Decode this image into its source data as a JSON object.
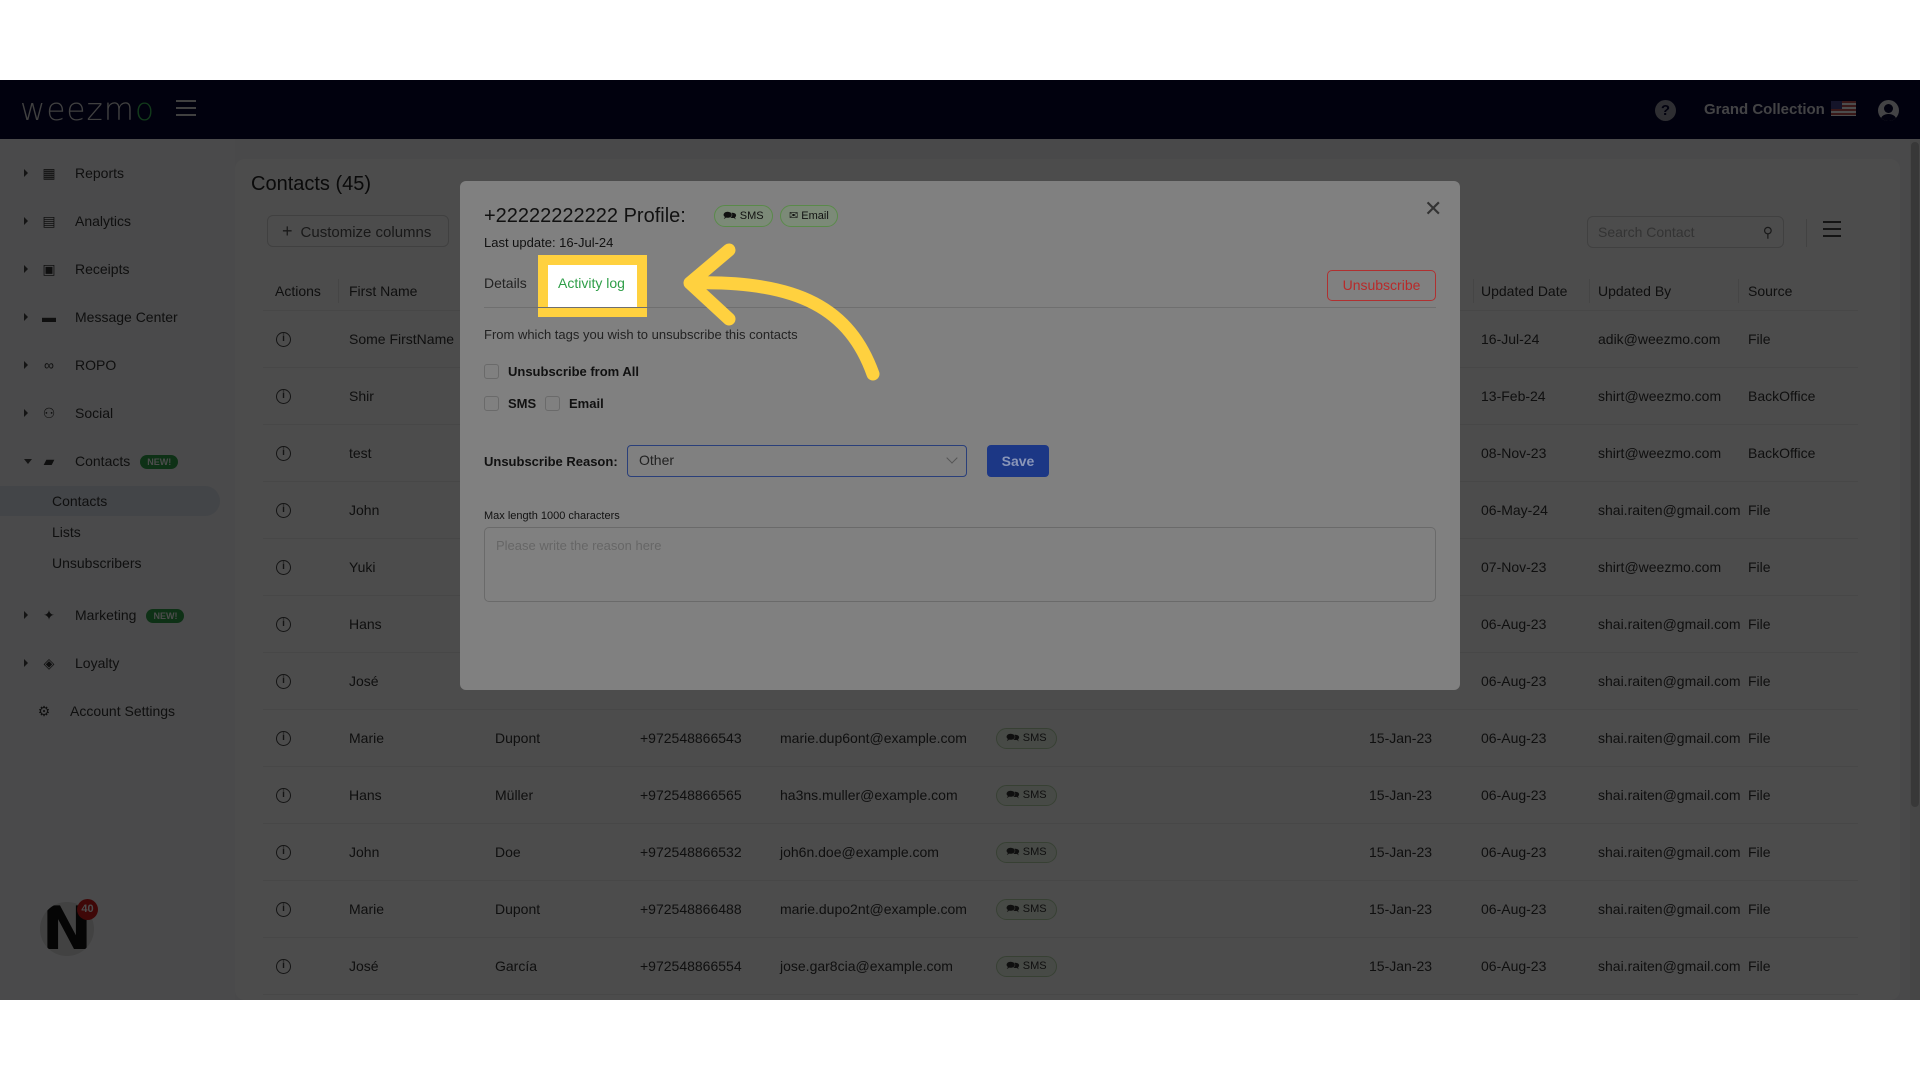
{
  "app": {
    "logo": "weezm",
    "logo_accent": "o",
    "store_name": "Grand Collection",
    "help_icon": "?"
  },
  "sidebar": {
    "items": [
      {
        "label": "Reports",
        "icon": "grid-icon"
      },
      {
        "label": "Analytics",
        "icon": "bar-chart-icon"
      },
      {
        "label": "Receipts",
        "icon": "receipt-icon"
      },
      {
        "label": "Message Center",
        "icon": "chat-icon"
      },
      {
        "label": "ROPO",
        "icon": "infinity-icon"
      },
      {
        "label": "Social",
        "icon": "people-icon"
      },
      {
        "label": "Contacts",
        "icon": "contact-book-icon",
        "badge": "NEW!",
        "expanded": true
      },
      {
        "label": "Marketing",
        "icon": "party-popper-icon",
        "badge": "NEW!"
      },
      {
        "label": "Loyalty",
        "icon": "tag-icon"
      },
      {
        "label": "Account Settings",
        "icon": "gear-icon"
      }
    ],
    "contacts_sub": [
      "Contacts",
      "Lists",
      "Unsubscribers"
    ],
    "active_sub": "Contacts",
    "notification_count": "40"
  },
  "main": {
    "title": "Contacts (45)",
    "customize_label": "Customize columns",
    "search_placeholder": "Search Contact",
    "columns": [
      "Actions",
      "First Name",
      "Updated Date",
      "Updated By",
      "Source"
    ],
    "rows": [
      {
        "first": "Some FirstName",
        "last": "",
        "phone": "",
        "email": "",
        "channel": "",
        "created": "",
        "updated": "16-Jul-24",
        "by": "adik@weezmo.com",
        "source": "File"
      },
      {
        "first": "Shir",
        "last": "",
        "phone": "",
        "email": "",
        "channel": "",
        "created": "",
        "updated": "13-Feb-24",
        "by": "shirt@weezmo.com",
        "source": "BackOffice"
      },
      {
        "first": "test",
        "last": "",
        "phone": "",
        "email": "",
        "channel": "",
        "created": "",
        "updated": "08-Nov-23",
        "by": "shirt@weezmo.com",
        "source": "BackOffice"
      },
      {
        "first": "John",
        "last": "",
        "phone": "",
        "email": "",
        "channel": "",
        "created": "",
        "updated": "06-May-24",
        "by": "shai.raiten@gmail.com",
        "source": "File"
      },
      {
        "first": "Yuki",
        "last": "",
        "phone": "",
        "email": "",
        "channel": "",
        "created": "",
        "updated": "07-Nov-23",
        "by": "shirt@weezmo.com",
        "source": "File"
      },
      {
        "first": "Hans",
        "last": "",
        "phone": "",
        "email": "",
        "channel": "",
        "created": "",
        "updated": "06-Aug-23",
        "by": "shai.raiten@gmail.com",
        "source": "File"
      },
      {
        "first": "José",
        "last": "",
        "phone": "",
        "email": "",
        "channel": "",
        "created": "",
        "updated": "06-Aug-23",
        "by": "shai.raiten@gmail.com",
        "source": "File"
      },
      {
        "first": "Marie",
        "last": "Dupont",
        "phone": "+972548866543",
        "email": "marie.dup6ont@example.com",
        "channel": "SMS",
        "created": "15-Jan-23",
        "updated": "06-Aug-23",
        "by": "shai.raiten@gmail.com",
        "source": "File"
      },
      {
        "first": "Hans",
        "last": "Müller",
        "phone": "+972548866565",
        "email": "ha3ns.muller@example.com",
        "channel": "SMS",
        "created": "15-Jan-23",
        "updated": "06-Aug-23",
        "by": "shai.raiten@gmail.com",
        "source": "File"
      },
      {
        "first": "John",
        "last": "Doe",
        "phone": "+972548866532",
        "email": "joh6n.doe@example.com",
        "channel": "SMS",
        "created": "15-Jan-23",
        "updated": "06-Aug-23",
        "by": "shai.raiten@gmail.com",
        "source": "File"
      },
      {
        "first": "Marie",
        "last": "Dupont",
        "phone": "+972548866488",
        "email": "marie.dupo2nt@example.com",
        "channel": "SMS",
        "created": "15-Jan-23",
        "updated": "06-Aug-23",
        "by": "shai.raiten@gmail.com",
        "source": "File"
      },
      {
        "first": "José",
        "last": "García",
        "phone": "+972548866554",
        "email": "jose.gar8cia@example.com",
        "channel": "SMS",
        "created": "15-Jan-23",
        "updated": "06-Aug-23",
        "by": "shai.raiten@gmail.com",
        "source": "File"
      }
    ]
  },
  "modal": {
    "title": "+22222222222 Profile:",
    "chips": [
      "SMS",
      "Email"
    ],
    "last_update": "Last update: 16-Jul-24",
    "tabs": [
      "Details",
      "Activity log"
    ],
    "highlighted_tab": "Activity log",
    "unsubscribe_label": "Unsubscribe",
    "question": "From which tags you wish to unsubscribe this contacts",
    "checkboxes": [
      {
        "label": "Unsubscribe from All",
        "checked": false
      },
      {
        "label": "SMS",
        "checked": false
      },
      {
        "label": "Email",
        "checked": false
      }
    ],
    "reason_label": "Unsubscribe Reason:",
    "reason_value": "Other",
    "save_label": "Save",
    "max_length_note": "Max length 1000 characters",
    "reason_placeholder": "Please write the reason here"
  },
  "colors": {
    "topbar": "#05052f",
    "accent_green": "#2e9e48",
    "highlight_yellow": "#ffd13f",
    "danger_red": "#b82a2a",
    "primary_blue": "#1c3785"
  }
}
